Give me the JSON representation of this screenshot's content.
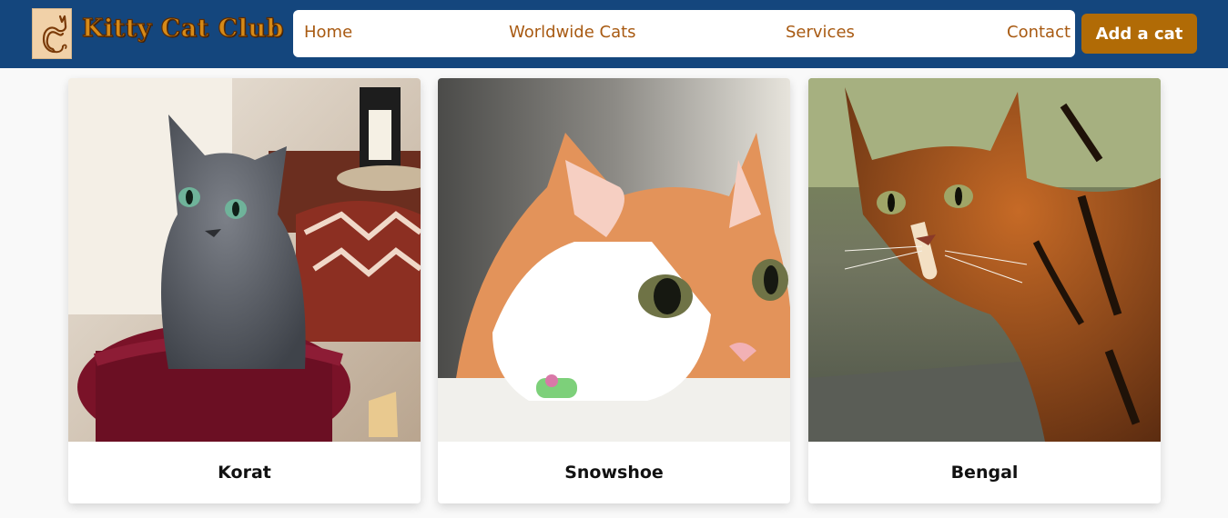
{
  "header": {
    "logo_title": "Kitty Cat Club",
    "nav": {
      "home": "Home",
      "worldwide": "Worldwide Cats",
      "services": "Services",
      "contact": "Contact"
    },
    "add_button": "Add a cat"
  },
  "cards": [
    {
      "name": "Korat"
    },
    {
      "name": "Snowshoe"
    },
    {
      "name": "Bengal"
    }
  ],
  "colors": {
    "header_bg": "#14467d",
    "nav_link": "#a85a12",
    "button_bg": "#b16b06",
    "logo_text": "#d68a17"
  },
  "icons": {
    "logo": "cat-silhouette-icon"
  }
}
